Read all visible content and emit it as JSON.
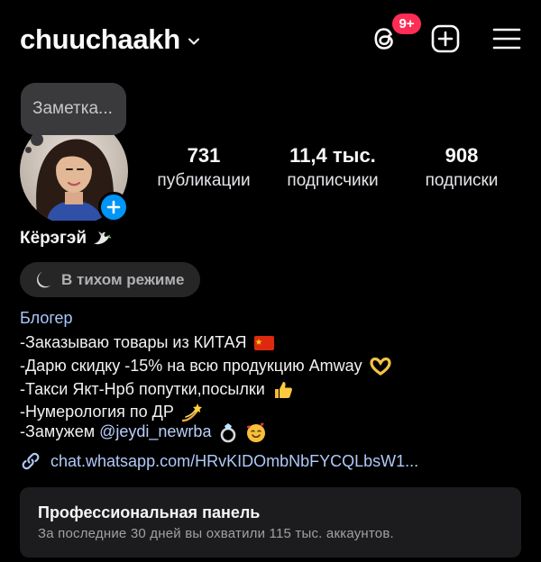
{
  "header": {
    "username": "chuuchaakh",
    "notification_badge": "9+",
    "icons": [
      "chevron-down-icon",
      "threads-icon",
      "add-post-icon",
      "menu-icon"
    ]
  },
  "note": {
    "placeholder": "Заметка..."
  },
  "stats": [
    {
      "value": "731",
      "label": "публикации"
    },
    {
      "value": "11,4 тыс.",
      "label": "подписчики"
    },
    {
      "value": "908",
      "label": "подписки"
    }
  ],
  "profile": {
    "display_name": "Кёрэгэй",
    "quiet_mode": "В тихом режиме",
    "category": "Блогер",
    "bio": [
      "-Заказываю товары из КИТАЯ",
      "-Дарю скидку -15% на всю продукцию Amway",
      "-Такси Якт-Нрб попутки,посылки",
      "-Нумерология по ДР",
      "-Замужем"
    ],
    "mention": "@jeydi_newrba",
    "link": "chat.whatsapp.com/HRvKIDOmbNbFYCQLbsW1..."
  },
  "dashboard": {
    "title": "Профессиональная панель",
    "subtitle": "За последние 30 дней вы охватили 115 тыс. аккаунтов."
  },
  "colors": {
    "background": "#000000",
    "accent": "#0095f6",
    "badge": "#ff2d55",
    "link": "#b0c9f8"
  }
}
